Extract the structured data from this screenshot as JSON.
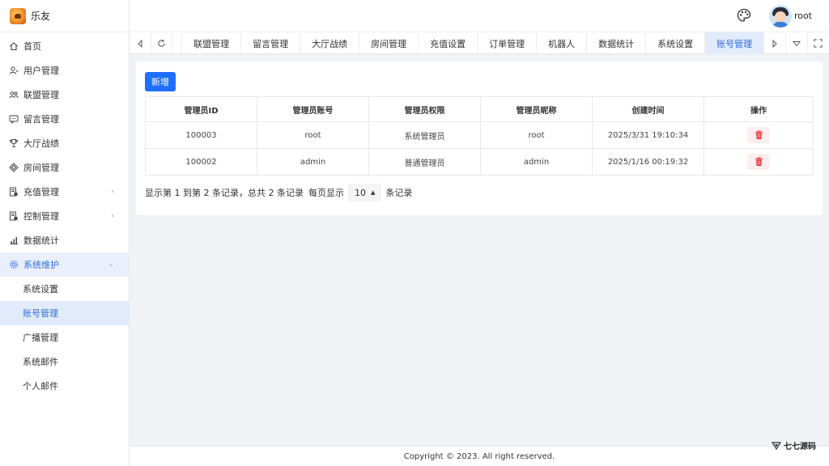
{
  "brand": {
    "name": "乐友"
  },
  "sidebar": {
    "items": [
      {
        "label": "首页",
        "icon": "home-icon"
      },
      {
        "label": "用户管理",
        "icon": "user-icon"
      },
      {
        "label": "联盟管理",
        "icon": "group-icon"
      },
      {
        "label": "留言管理",
        "icon": "message-icon"
      },
      {
        "label": "大厅战绩",
        "icon": "trophy-icon"
      },
      {
        "label": "房间管理",
        "icon": "room-icon"
      },
      {
        "label": "充值管理",
        "icon": "recharge-icon"
      },
      {
        "label": "控制管理",
        "icon": "control-icon"
      },
      {
        "label": "数据统计",
        "icon": "chart-icon"
      },
      {
        "label": "系统维护",
        "icon": "gear-icon"
      }
    ],
    "submenu": [
      {
        "label": "系统设置"
      },
      {
        "label": "账号管理"
      },
      {
        "label": "广播管理"
      },
      {
        "label": "系统邮件"
      },
      {
        "label": "个人邮件"
      }
    ]
  },
  "header": {
    "username": "root"
  },
  "tabs": [
    {
      "label": "联盟管理"
    },
    {
      "label": "留言管理"
    },
    {
      "label": "大厅战绩"
    },
    {
      "label": "房间管理"
    },
    {
      "label": "充值设置"
    },
    {
      "label": "订单管理"
    },
    {
      "label": "机器人"
    },
    {
      "label": "数据统计"
    },
    {
      "label": "系统设置"
    },
    {
      "label": "账号管理"
    }
  ],
  "toolbar": {
    "add_label": "新增"
  },
  "table": {
    "columns": [
      "管理员ID",
      "管理员账号",
      "管理员权限",
      "管理员昵称",
      "创建时间",
      "操作"
    ],
    "rows": [
      {
        "id": "100003",
        "account": "root",
        "role": "系统管理员",
        "nickname": "root",
        "created": "2025/3/31 19:10:34"
      },
      {
        "id": "100002",
        "account": "admin",
        "role": "普通管理员",
        "nickname": "admin",
        "created": "2025/1/16 00:19:32"
      }
    ]
  },
  "pager": {
    "summary": "显示第 1 到第 2 条记录，总共 2 条记录",
    "per_page_label": "每页显示",
    "page_size": "10",
    "records_label": "条记录"
  },
  "footer": {
    "copyright": "Copyright © 2023. All right reserved."
  },
  "watermark": {
    "text": "七七源码"
  },
  "colors": {
    "accent": "#1e6fff",
    "active_bg": "#e2ebfb",
    "danger": "#e5353b"
  }
}
